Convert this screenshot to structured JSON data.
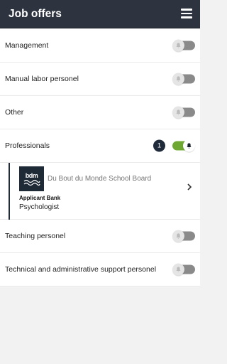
{
  "header": {
    "title": "Job offers",
    "menu_icon": "hamburger-menu-icon"
  },
  "categories": [
    {
      "label": "Management",
      "subscribed": false
    },
    {
      "label": "Manual labor personel",
      "subscribed": false
    },
    {
      "label": "Other",
      "subscribed": false
    },
    {
      "label": "Professionals",
      "subscribed": true,
      "count": "1"
    }
  ],
  "job": {
    "organization": "Du Bout du Monde School Board",
    "logo_text": "bdm",
    "category": "Applicant Bank",
    "position": "Psychologist"
  },
  "categories_after": [
    {
      "label": "Teaching personel",
      "subscribed": false
    },
    {
      "label": "Technical and administrative support personel",
      "subscribed": false
    }
  ],
  "colors": {
    "header": "#2d3440",
    "toggle_on": "#6ea832",
    "toggle_off": "#8a8a8a",
    "badge": "#1f2a3a"
  }
}
